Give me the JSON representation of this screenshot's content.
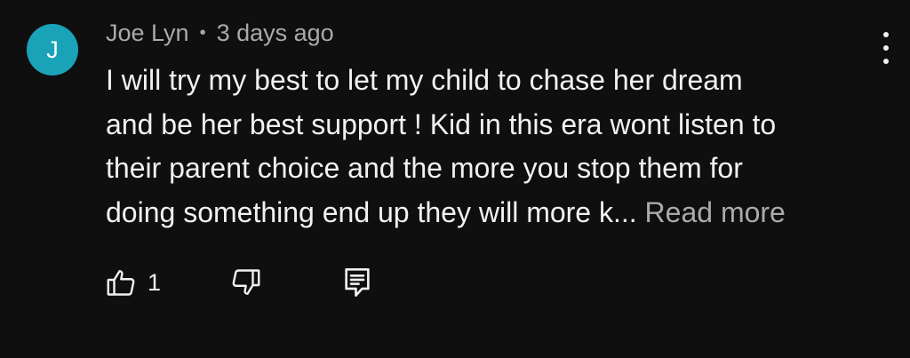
{
  "comment": {
    "avatar_letter": "J",
    "avatar_color": "#1aa3b8",
    "author": "Joe Lyn",
    "separator": "•",
    "time": "3 days ago",
    "text_lines": [
      "I will try my best to let my child to chase her dream",
      "and be her best support ! Kid in this era wont listen to",
      "their parent choice and the more you stop them for",
      "doing something end up they will more k..."
    ],
    "read_more": "Read more",
    "like_count": "1",
    "icons": {
      "like": "thumbs-up-icon",
      "dislike": "thumbs-down-icon",
      "reply": "reply-comment-icon",
      "menu": "more-vertical-icon"
    }
  },
  "colors": {
    "background": "#0f0f0f",
    "text_primary": "#f1f1f1",
    "text_secondary": "#aaaaaa"
  }
}
